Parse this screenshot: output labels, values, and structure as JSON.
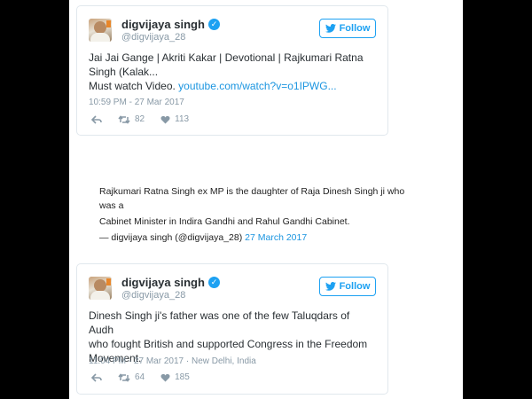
{
  "tweet1": {
    "name": "digvijaya singh",
    "handle": "@digvijaya_28",
    "follow_label": "Follow",
    "text_line1": "Jai Jai Gange | Akriti Kakar | Devotional | Rajkumari Ratna",
    "text_line2": "Singh (Kalak...",
    "text_line3_prefix": "Must watch Video. ",
    "link": "youtube.com/watch?v=o1IPWG...",
    "timestamp": "10:59 PM - 27 Mar 2017",
    "retweets": "82",
    "likes": "113"
  },
  "quote": {
    "line1": "Rajkumari Ratna Singh ex MP is the daughter of Raja Dinesh Singh ji who was a",
    "line2": "Cabinet Minister in Indira Gandhi and Rahul Gandhi Cabinet.",
    "attribution": "— digvijaya singh (@digvijaya_28) ",
    "date": "27 March 2017"
  },
  "tweet2": {
    "name": "digvijaya singh",
    "handle": "@digvijaya_28",
    "follow_label": "Follow",
    "text_line1": "Dinesh Singh ji's father was one of the few Taluqdars of Audh",
    "text_line2": "who fought British and supported Congress in the Freedom",
    "text_line3": "Movement.",
    "timestamp": "11:04 PM - 27 Mar 2017 · New Delhi, India",
    "retweets": "64",
    "likes": "185"
  },
  "colors": {
    "accent": "#1da1f2",
    "link": "#1b95e0",
    "muted": "#8899a6"
  },
  "icons": [
    "verified-icon",
    "twitter-bird-icon",
    "reply-icon",
    "retweet-icon",
    "like-icon"
  ]
}
